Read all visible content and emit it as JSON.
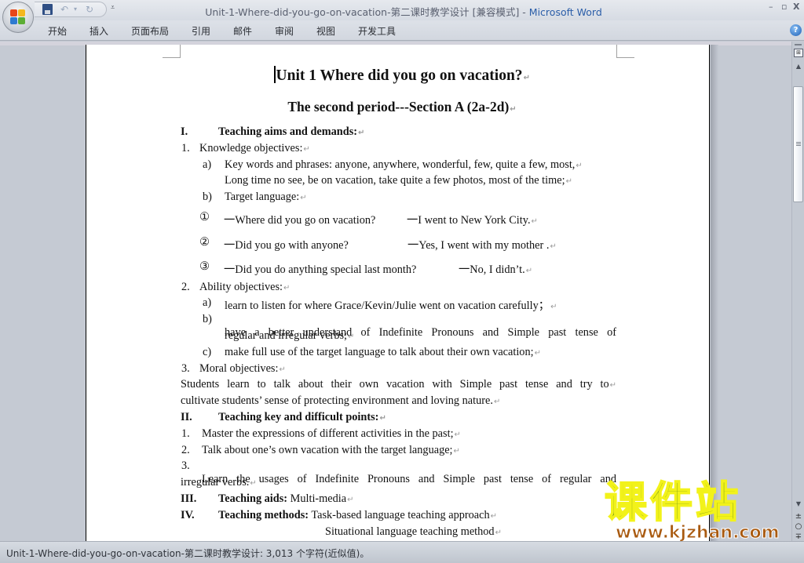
{
  "window": {
    "title_doc": "Unit-1-Where-did-you-go-on-vacation-第二课时教学设计 [兼容模式]",
    "title_sep": " - ",
    "title_app": "Microsoft Word",
    "controls": {
      "minimize": "–",
      "maximize": "▫",
      "close": "X"
    }
  },
  "qat": {
    "save_icon": "save-icon",
    "undo_glyph": "↶",
    "undo_dropdown": "▾",
    "redo_glyph": "↻",
    "customize_glyph": "⩡"
  },
  "ribbon": {
    "tabs": [
      "开始",
      "插入",
      "页面布局",
      "引用",
      "邮件",
      "审阅",
      "视图",
      "开发工具"
    ],
    "help_glyph": "?"
  },
  "document": {
    "title": "Unit 1 Where did you go on vacation?",
    "subtitle": "The second period---Section A (2a-2d)",
    "pilcrow": "↵",
    "sections": {
      "s1": {
        "num": "I.",
        "title": "Teaching aims and demands:"
      },
      "k": {
        "num": "1.",
        "text": "Knowledge objectives:"
      },
      "ka": {
        "letter": "a)",
        "line1": "Key words and phrases: anyone, anywhere, wonderful, few, quite a few, most,",
        "line2": "Long time no see, be on vacation, take quite a few photos, most of the time;"
      },
      "kb": {
        "letter": "b)",
        "text": "Target language:"
      },
      "dialogs": [
        {
          "num": "①",
          "q": "一Where did you go on vacation?",
          "a": "一I went to New York City."
        },
        {
          "num": "②",
          "q": "一Did you go with anyone?",
          "a": "一Yes, I went with my mother ."
        },
        {
          "num": "③",
          "q": "一Did you do anything special last month?",
          "a": "一No, I didn’t."
        }
      ],
      "ab": {
        "num": "2.",
        "text": "Ability objectives:"
      },
      "aba": {
        "letter": "a)",
        "text": "learn to listen for where Grace/Kevin/Julie went on vacation carefully；"
      },
      "abb": {
        "letter": "b)",
        "line1": "have a better understand of Indefinite Pronouns and Simple past tense of",
        "line2": "regular and irregular verbs;"
      },
      "abc": {
        "letter": "c)",
        "text": "make full use of the target language to talk about their own vacation;"
      },
      "mo": {
        "num": "3.",
        "text": "Moral objectives:"
      },
      "mo_para": {
        "line1": "Students learn to talk about their own vacation with Simple past tense and try to",
        "line2": "cultivate students’ sense of protecting environment and loving nature."
      },
      "s2": {
        "num": "II.",
        "title": "Teaching key and difficult points:"
      },
      "p1": {
        "num": "1.",
        "text": "Master the expressions of different activities in the past;"
      },
      "p2": {
        "num": "2.",
        "text": "Talk about one’s own vacation with the target language;"
      },
      "p3": {
        "num": "3.",
        "line1": "Learn the usages of Indefinite Pronouns and Simple past tense of regular and",
        "line2": "irregular verbs."
      },
      "s3": {
        "num": "III.",
        "title": "Teaching aids:",
        "value": "Multi-media"
      },
      "s4": {
        "num": "IV.",
        "title": "Teaching methods:",
        "value": "Task-based language teaching approach",
        "value2": "Situational language teaching method"
      }
    }
  },
  "scrollbar": {
    "up": "▲",
    "down": "▼",
    "prev_page": "±",
    "browse_object": "○",
    "next_page": "∓",
    "ruler_glyph": "⊞"
  },
  "status_bar": {
    "text": "Unit-1-Where-did-you-go-on-vacation-第二课时教学设计: 3,013 个字符(近似值)。"
  },
  "watermark": {
    "cn": "课件站",
    "url": "www.kjzhan.com",
    "green": "#5a8a12",
    "yellow": "#f2f21a",
    "brown": "#a95a10"
  }
}
